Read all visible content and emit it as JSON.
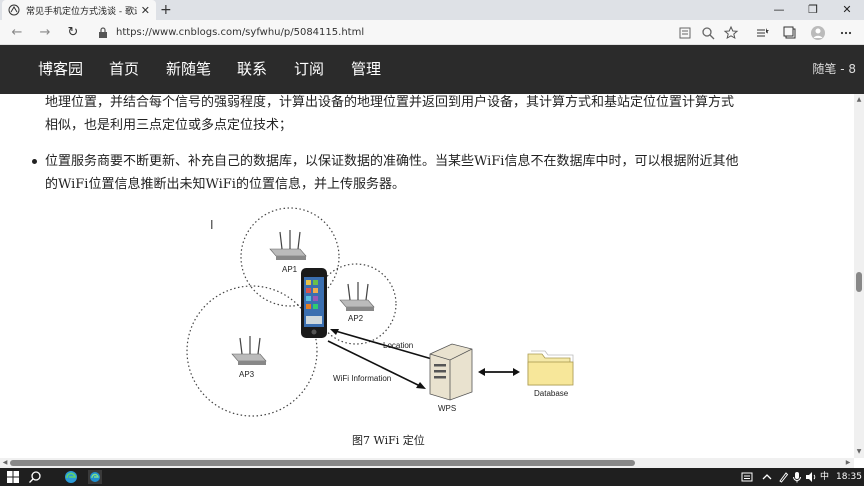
{
  "browser": {
    "tab_title": "常见手机定位方式浅谈 - 歌遇 - 博",
    "tab_close": "✕",
    "new_tab": "+",
    "url": "https://www.cnblogs.com/syfwhu/p/5084115.html",
    "window_controls": {
      "minimize": "—",
      "maximize": "❐",
      "close": "✕"
    },
    "nav_buttons": {
      "back": "←",
      "forward": "→",
      "refresh": "↻"
    }
  },
  "blog_nav": {
    "items": [
      "博客园",
      "首页",
      "新随笔",
      "联系",
      "订阅",
      "管理"
    ],
    "right_text": "随笔 - 8"
  },
  "article": {
    "para1_line1": "地理位置，并结合每个信号的强弱程度，计算出设备的地理位置并返回到用户设备，其计算方式和基站定位位置计算方式",
    "para1_line2": "相似，也是利用三点定位或多点定位技术；",
    "bullet_line1": "位置服务商要不断更新、补充自己的数据库，以保证数据的准确性。当某些WiFi信息不在数据库中时，可以根据附近其他",
    "bullet_line2": "的WiFi位置信息推断出未知WiFi的位置信息，并上传服务器。",
    "diagram": {
      "ap1": "AP1",
      "ap2": "AP2",
      "ap3": "AP3",
      "location": "Location",
      "wifi_information": "WiFi Information",
      "wps": "WPS",
      "database": "Database"
    },
    "caption": "图7 WiFi 定位"
  },
  "taskbar": {
    "time": "18:35",
    "tray_text": "中"
  },
  "colors": {
    "nav_bg": "#2b2b2b",
    "tabstrip_bg": "#dee1e6",
    "taskbar_bg": "#1f1f1f"
  }
}
